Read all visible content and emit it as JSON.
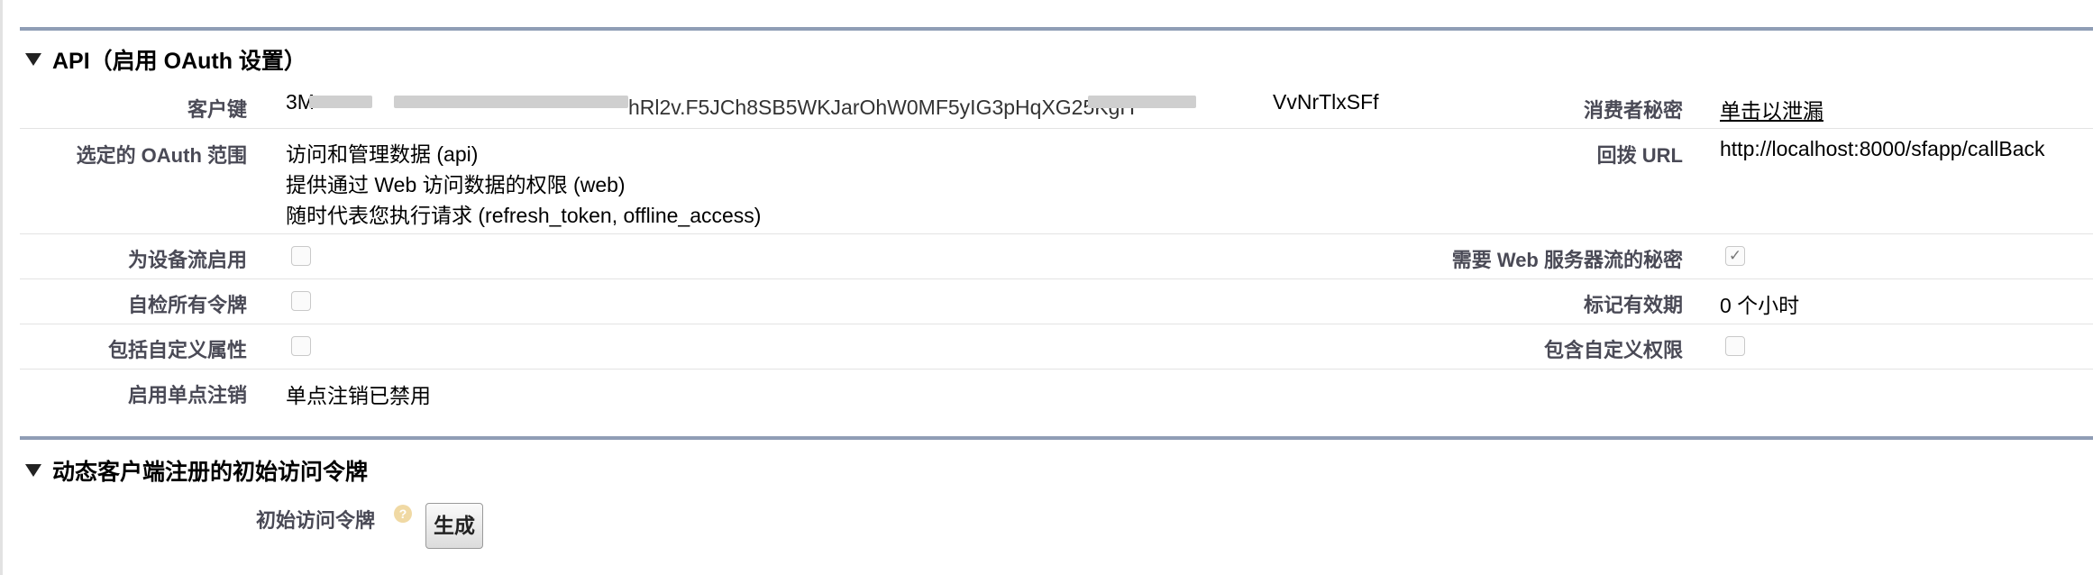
{
  "colors": {
    "section_rule": "#8f9db5",
    "label": "#4a4a56",
    "row_separator": "#e3e3e3"
  },
  "sections": [
    {
      "title": "API（启用 OAuth 设置）"
    },
    {
      "title": "动态客户端注册的初始访问令牌"
    }
  ],
  "oauth": {
    "consumer_key": {
      "label": "客户键",
      "value": "3MVG9...p...SEJ...WZhRl2v.F5JCh8SB5WKJarOhW0MF5yIG3pHqXG25KgH...VVNrTlxSFf",
      "value_visible_tail": "VvNrTlxSFf"
    },
    "consumer_secret": {
      "label": "消费者秘密",
      "link": "单击以泄漏"
    },
    "scopes": {
      "label": "选定的 OAuth 范围",
      "items": [
        "访问和管理数据 (api)",
        "提供通过 Web 访问数据的权限 (web)",
        "随时代表您执行请求 (refresh_token, offline_access)"
      ]
    },
    "callback": {
      "label": "回拨 URL",
      "value": "http://localhost:8000/sfapp/callBack"
    },
    "device_flow": {
      "label": "为设备流启用",
      "checked": false
    },
    "web_server_secret": {
      "label": "需要 Web 服务器流的秘密",
      "checked": true
    },
    "introspect": {
      "label": "自检所有令牌",
      "checked": false
    },
    "token_valid": {
      "label": "标记有效期",
      "value": "0 个小时"
    },
    "custom_attrs": {
      "label": "包括自定义属性",
      "checked": false
    },
    "custom_perms": {
      "label": "包含自定义权限",
      "checked": false
    },
    "sso_logout": {
      "label": "启用单点注销",
      "value": "单点注销已禁用"
    }
  },
  "initial_token": {
    "label": "初始访问令牌",
    "help_icon": "help-icon",
    "button": "生成"
  }
}
